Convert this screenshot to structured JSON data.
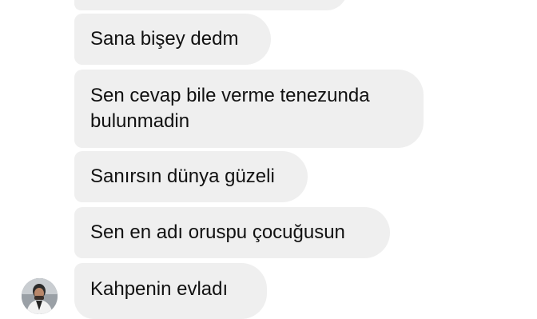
{
  "conversation": {
    "messages": [
      {
        "text": ""
      },
      {
        "text": "Sana bişey dedm"
      },
      {
        "text": "Sen cevap bile verme tenezunda bulunmadin"
      },
      {
        "text": "Sanırsın dünya güzeli"
      },
      {
        "text": "Sen en adı oruspu çocuğusun"
      },
      {
        "text": "Kahpenin evladı"
      }
    ]
  },
  "sender": {
    "avatar_icon": "profile-photo-icon"
  },
  "colors": {
    "background": "#ffffff",
    "bubble": "#efefef",
    "text": "#111111"
  }
}
